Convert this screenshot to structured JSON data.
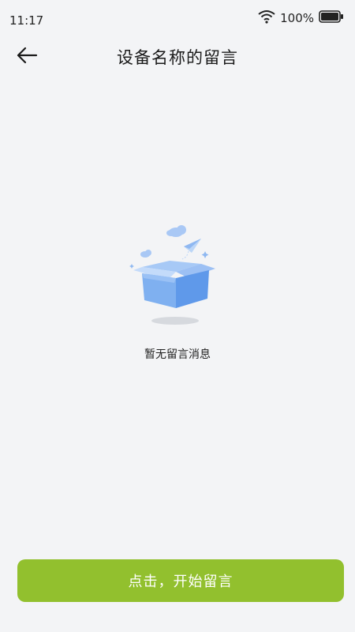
{
  "status_bar": {
    "time": "11:17",
    "battery_percent": "100%",
    "icons": [
      "wifi-icon",
      "battery-icon"
    ]
  },
  "header": {
    "title": "设备名称的留言",
    "back_icon": "arrow-left-icon"
  },
  "empty_state": {
    "illustration": "empty-box-icon",
    "message": "暂无留言消息"
  },
  "footer": {
    "button_label": "点击，开始留言"
  },
  "colors": {
    "background": "#f3f4f6",
    "accent": "#92c02e",
    "box_blue": "#7fb0f0"
  }
}
